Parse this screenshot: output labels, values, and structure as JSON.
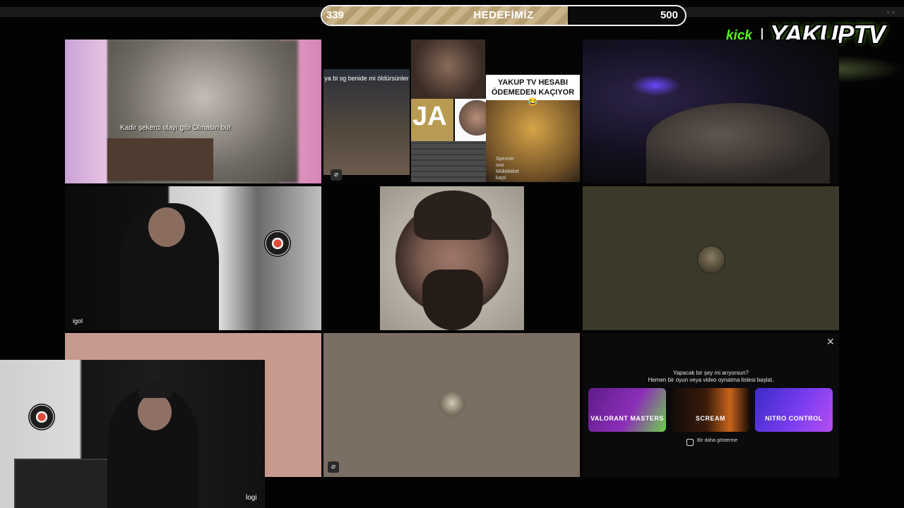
{
  "goal": {
    "min_label": "339",
    "title": "HEDEFİMİZ",
    "max_label": "500",
    "progress_fraction": 0.678
  },
  "logo": {
    "platform": "kick",
    "brand": "YAKUPTV"
  },
  "tiles": {
    "tile1": {
      "caption": "Kadir şekerci olayı gibi Olmasın bu!"
    },
    "tile2": {
      "video_text": "ya bi sg benide mi öldürsünler",
      "ja_text": "JA",
      "headline": "YAKUP TV HESABI ÖDEMEDEN KAÇIYOR 😂",
      "side_text": [
        "Spencer",
        "ooo",
        "Mükkkkkel",
        "kaçti"
      ]
    },
    "tile4": {
      "label": "igol"
    },
    "cam": {
      "label": "logi"
    }
  },
  "activity_panel": {
    "question": "Yapacak bir şey mi arıyorsun?",
    "subtitle": "Hemen bir oyun veya video oynatma listesi başlat.",
    "cards": [
      "VALORANT MASTERS",
      "SCREAM",
      "NITRO CONTROL"
    ],
    "checkbox_label": "Bir daha gösterme",
    "close_glyph": "✕"
  },
  "icons": {
    "mute": "mic-off-icon",
    "close": "close-icon"
  },
  "colors": {
    "kick_green": "#53fc18",
    "goal_fill": "#c9b48a",
    "tile_pink": "#c69a8e",
    "tile_taupe": "#7b6e62",
    "tile_olive": "#3b3a2a"
  }
}
